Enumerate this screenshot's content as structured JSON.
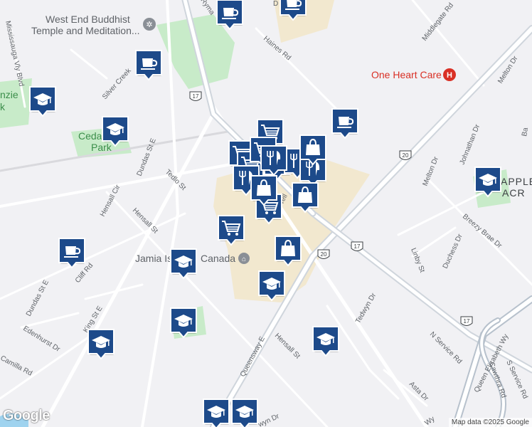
{
  "map": {
    "places": [
      {
        "id": "buddhist-temple",
        "text": "West End Buddhist",
        "text2": "Temple and Meditation..."
      },
      {
        "id": "one-heart-care",
        "text": "One Heart Care"
      },
      {
        "id": "cedar-park",
        "text": "Ceda",
        "text2": "Park"
      },
      {
        "id": "mckenzie-park",
        "text": "nzie",
        "text2": "k"
      },
      {
        "id": "jamia-islamic",
        "text": "Jamia Is",
        "text2": "Canada"
      },
      {
        "id": "applewood-acres",
        "text": "APPLE",
        "text2": "ACR"
      }
    ],
    "streets": [
      {
        "id": "mississauga-vly-blvd",
        "text": "Mississauga Vly Blvd"
      },
      {
        "id": "haines-rd",
        "text": "Haines Rd"
      },
      {
        "id": "middlegate-rd",
        "text": "Middlegate Rd"
      },
      {
        "id": "melton-dr-n",
        "text": "Melton Dr"
      },
      {
        "id": "silver-creek",
        "text": "Silver Creek"
      },
      {
        "id": "dundas-st-e-1",
        "text": "Dundas St E"
      },
      {
        "id": "dundas-st-e-2",
        "text": "Dundas St E"
      },
      {
        "id": "hensall-cir",
        "text": "Hensall Cir"
      },
      {
        "id": "tedlo-st",
        "text": "Tedlo St"
      },
      {
        "id": "hensall-st-1",
        "text": "Hensall St"
      },
      {
        "id": "hensall-st-2",
        "text": "Hensall St"
      },
      {
        "id": "cliff-rd",
        "text": "Cliff Rd"
      },
      {
        "id": "king-st-e",
        "text": "King St E"
      },
      {
        "id": "edenhurst-dr",
        "text": "Edenhurst Dr"
      },
      {
        "id": "camilla-rd",
        "text": "Camilla Rd"
      },
      {
        "id": "queensway-e",
        "text": "Queensway E"
      },
      {
        "id": "tedwyn-dr",
        "text": "Tedwyn Dr"
      },
      {
        "id": "johnathan-dr",
        "text": "Johnathan Dr"
      },
      {
        "id": "melton-dr",
        "text": "Melton Dr"
      },
      {
        "id": "breezy-brae-dr",
        "text": "Breezy Brae Dr"
      },
      {
        "id": "duchess-dr",
        "text": "Duchess Dr"
      },
      {
        "id": "linby-st",
        "text": "Linby St"
      },
      {
        "id": "n-service-rd",
        "text": "N Service Rd"
      },
      {
        "id": "queen-elizabeth-wy",
        "text": "Queen Elizabeth Wy"
      },
      {
        "id": "cawthra-rd",
        "text": "Cawthra Rd"
      },
      {
        "id": "s-service-rd",
        "text": "S Service Rd"
      },
      {
        "id": "asta-dr",
        "text": "Asta Dr"
      },
      {
        "id": "rymal",
        "text": "Ryma"
      },
      {
        "id": "d-partial",
        "text": "D"
      },
      {
        "id": "wy-partial",
        "text": "Wy"
      },
      {
        "id": "bal-partial",
        "text": "Ba"
      },
      {
        "id": "well-partial",
        "text": "well"
      },
      {
        "id": "wyn-dr-partial",
        "text": "wyn Dr"
      }
    ],
    "shields": [
      {
        "id": "hwy-17-a",
        "text": "17"
      },
      {
        "id": "hwy-20-a",
        "text": "20"
      },
      {
        "id": "hwy-20-b",
        "text": "20"
      },
      {
        "id": "hwy-17-b",
        "text": "17"
      },
      {
        "id": "hwy-17-c",
        "text": "17"
      }
    ],
    "markers": [
      {
        "type": "cafe",
        "icon": "coffee-cup-icon"
      },
      {
        "type": "cafe",
        "icon": "coffee-cup-icon"
      },
      {
        "type": "cafe",
        "icon": "coffee-cup-icon"
      },
      {
        "type": "cafe",
        "icon": "coffee-cup-icon"
      },
      {
        "type": "cafe",
        "icon": "coffee-cup-icon"
      },
      {
        "type": "school",
        "icon": "graduation-cap-icon"
      },
      {
        "type": "school",
        "icon": "graduation-cap-icon"
      },
      {
        "type": "school",
        "icon": "graduation-cap-icon"
      },
      {
        "type": "school",
        "icon": "graduation-cap-icon"
      },
      {
        "type": "school",
        "icon": "graduation-cap-icon"
      },
      {
        "type": "school",
        "icon": "graduation-cap-icon"
      },
      {
        "type": "school",
        "icon": "graduation-cap-icon"
      },
      {
        "type": "school",
        "icon": "graduation-cap-icon"
      },
      {
        "type": "school",
        "icon": "graduation-cap-icon"
      },
      {
        "type": "school",
        "icon": "graduation-cap-icon"
      },
      {
        "type": "grocery",
        "icon": "shopping-cart-icon"
      },
      {
        "type": "grocery",
        "icon": "shopping-cart-icon"
      },
      {
        "type": "grocery",
        "icon": "shopping-cart-icon"
      },
      {
        "type": "grocery",
        "icon": "shopping-cart-icon"
      },
      {
        "type": "grocery",
        "icon": "shopping-cart-icon"
      },
      {
        "type": "grocery",
        "icon": "shopping-cart-icon"
      },
      {
        "type": "restaurant",
        "icon": "fork-knife-icon"
      },
      {
        "type": "restaurant",
        "icon": "fork-knife-icon"
      },
      {
        "type": "restaurant",
        "icon": "fork-knife-icon"
      },
      {
        "type": "restaurant",
        "icon": "fork-knife-icon"
      },
      {
        "type": "restaurant",
        "icon": "fork-knife-icon"
      },
      {
        "type": "shopping",
        "icon": "shopping-bag-icon"
      },
      {
        "type": "shopping",
        "icon": "shopping-bag-icon"
      },
      {
        "type": "shopping",
        "icon": "shopping-bag-icon"
      },
      {
        "type": "shopping",
        "icon": "shopping-bag-icon"
      }
    ]
  },
  "colors": {
    "background": "#f1f1f4",
    "park": "#c8ebc9",
    "commercial": "#f2e8cf",
    "road": "#ffffff",
    "highway": "#cfd5dc",
    "marker": "#1d4a8a",
    "hospital": "#d93025"
  },
  "branding": {
    "logo": "Google",
    "attribution": "Map data ©2025 Google"
  }
}
